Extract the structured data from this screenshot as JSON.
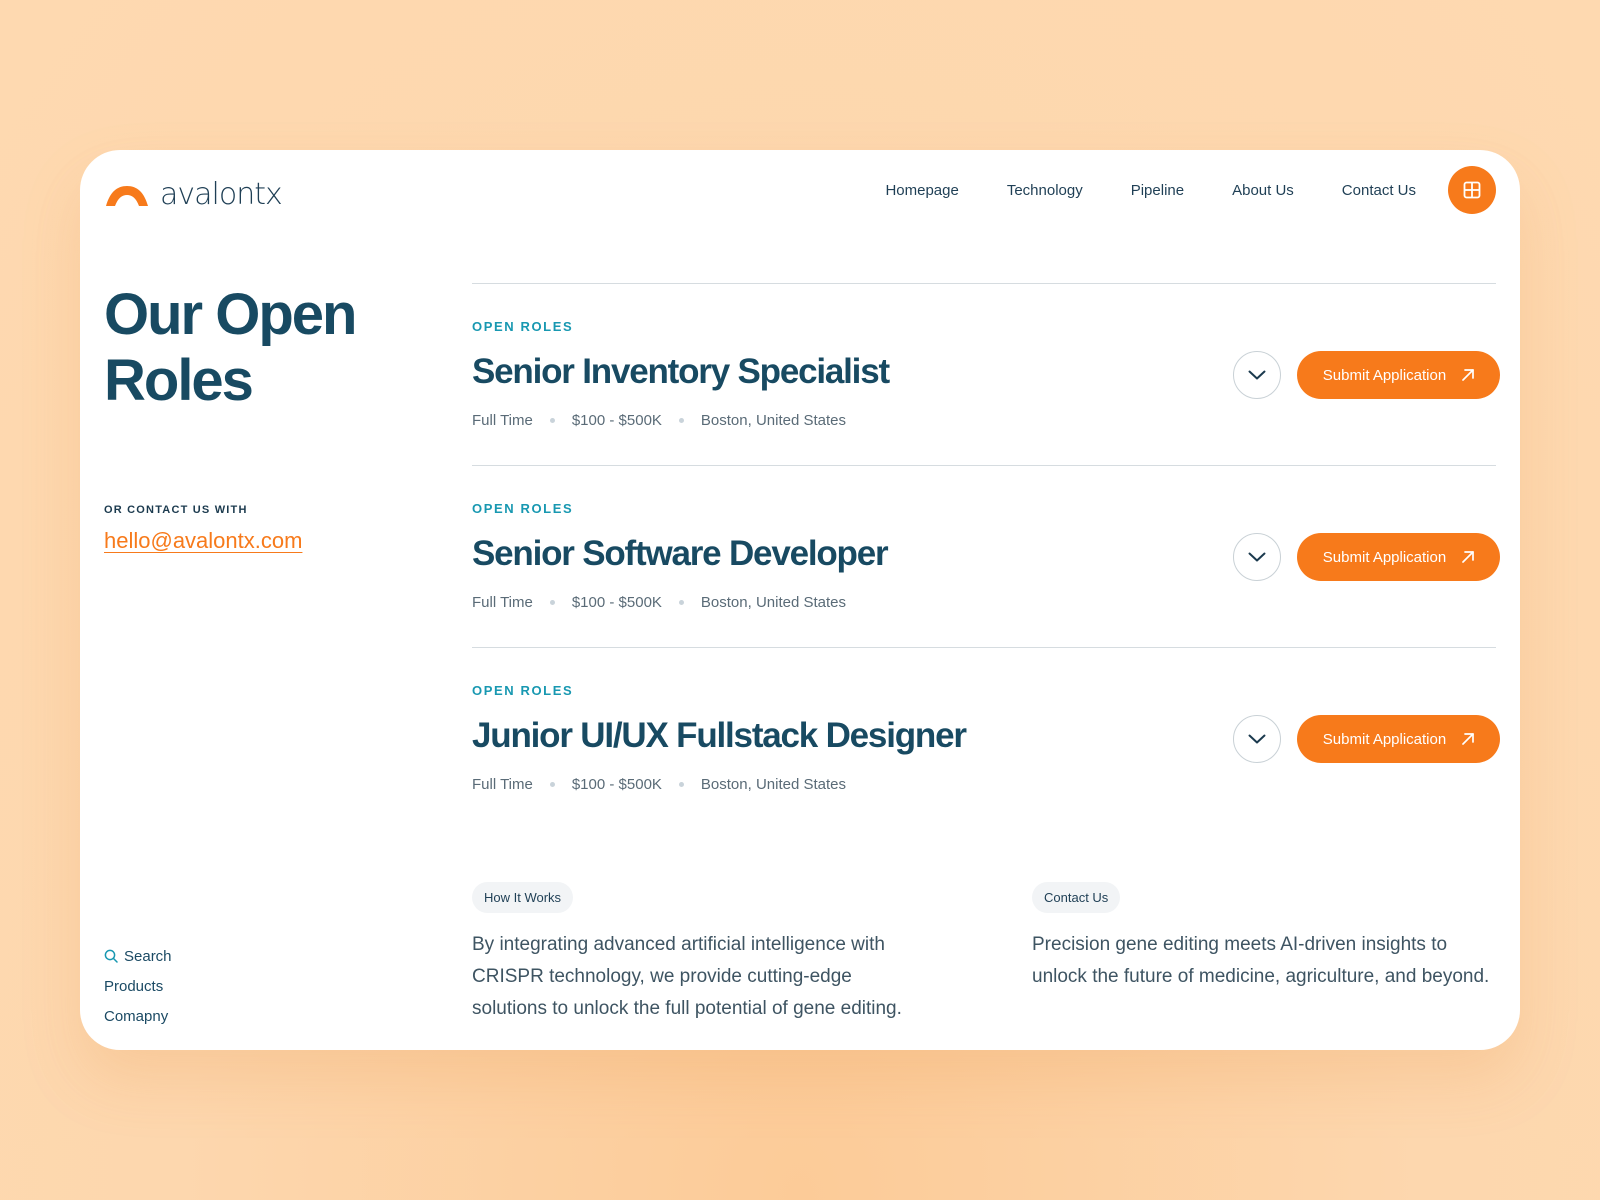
{
  "brand": {
    "name": "avalontx",
    "accent": "#F77A1B",
    "primary": "#184A62",
    "kicker": "#1898B1"
  },
  "nav": {
    "items": [
      "Homepage",
      "Technology",
      "Pipeline",
      "About Us",
      "Contact Us"
    ],
    "menu_icon": "grid-icon"
  },
  "page": {
    "title": "Our Open Roles",
    "contact_label": "OR CONTACT US WITH",
    "contact_email": "hello@avalontx.com"
  },
  "roles": [
    {
      "kicker": "OPEN ROLES",
      "title": "Senior Inventory Specialist",
      "type": "Full Time",
      "salary": "$100 - $500K",
      "location": "Boston, United States",
      "action": "Submit Application"
    },
    {
      "kicker": "OPEN ROLES",
      "title": "Senior Software Developer",
      "type": "Full Time",
      "salary": "$100 - $500K",
      "location": "Boston, United States",
      "action": "Submit Application"
    },
    {
      "kicker": "OPEN ROLES",
      "title": "Junior UI/UX Fullstack Designer",
      "type": "Full Time",
      "salary": "$100 - $500K",
      "location": "Boston, United States",
      "action": "Submit Application"
    }
  ],
  "info": [
    {
      "tag": "How It Works",
      "text": "By integrating advanced artificial intelligence with CRISPR technology, we provide cutting-edge solutions to unlock the full potential of gene editing."
    },
    {
      "tag": "Contact Us",
      "text": "Precision gene editing meets AI-driven insights to unlock the future of medicine, agriculture, and beyond."
    }
  ],
  "footer": {
    "links": [
      "Search",
      "Products",
      "Comapny"
    ]
  }
}
